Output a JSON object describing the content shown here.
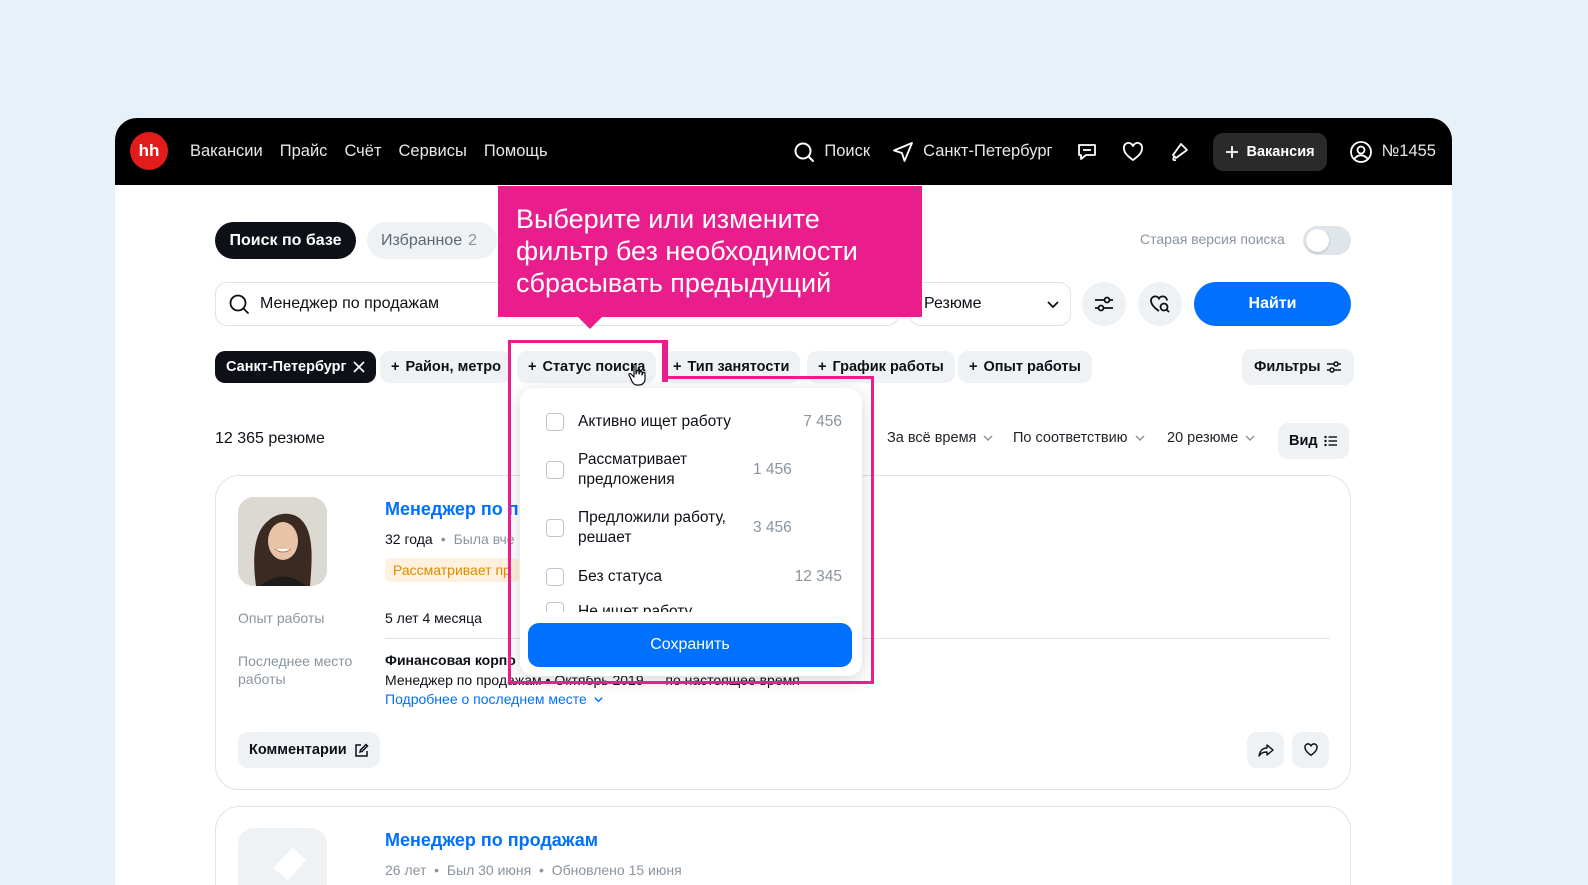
{
  "header": {
    "logo_text": "hh",
    "nav": [
      "Вакансии",
      "Прайс",
      "Счёт",
      "Сервисы",
      "Помощь"
    ],
    "search_label": "Поиск",
    "city_label": "Санкт-Петербург",
    "vacancy_button": "Вакансия",
    "account_label": "№1455"
  },
  "tabs": {
    "db_search": "Поиск по базе",
    "favorites": "Избранное",
    "favorites_count": "2",
    "old_version_label": "Старая версия поиска"
  },
  "search": {
    "query": "Менеджер по продажам",
    "type_selected": "Резюме",
    "find_button": "Найти"
  },
  "filters": {
    "city_chip": "Санкт-Петербург",
    "chips": [
      "Район, метро",
      "Статус поиска",
      "Тип занятости",
      "График работы",
      "Опыт работы"
    ],
    "filters_button": "Фильтры"
  },
  "results": {
    "count_label": "12 365 резюме",
    "period": "За всё время",
    "sort": "По соответствию",
    "per_page": "20 резюме",
    "view": "Вид"
  },
  "card1": {
    "title": "Менеджер по п",
    "age": "32 года",
    "was": "Была вче",
    "status_badge": "Рассматривает пр",
    "experience_label": "Опыт работы",
    "experience_value": "5 лет 4 месяца",
    "last_place_label": "Последнее место работы",
    "company": "Финансовая корпо",
    "position_line": "Менеджер по продажам • Октябрь 2019 — по настоящее время",
    "more_link": "Подробнее о последнем месте",
    "comments_button": "Комментарии"
  },
  "card2": {
    "title": "Менеджер по продажам",
    "meta": "26 лет  •  Был 30 июня  •  Обновлено 15 июня"
  },
  "dropdown": {
    "options": [
      {
        "label": "Активно ищет работу",
        "count": "7 456"
      },
      {
        "label": "Рассматривает предложения",
        "count": "1 456"
      },
      {
        "label": "Предложили работу, решает",
        "count": "3 456"
      },
      {
        "label": "Без статуса",
        "count": "12 345"
      },
      {
        "label": "Не ищет работу",
        "count": ""
      }
    ],
    "save_button": "Сохранить"
  },
  "callout": {
    "text": "Выберите или измените фильтр без необходимости сбрасывать предыдущий"
  },
  "colors": {
    "brand_red": "#e21b1b",
    "accent_blue": "#0070ff",
    "highlight_pink": "#e91e8c",
    "status_badge_bg": "#fff1dd",
    "status_badge_text": "#e08a00"
  }
}
